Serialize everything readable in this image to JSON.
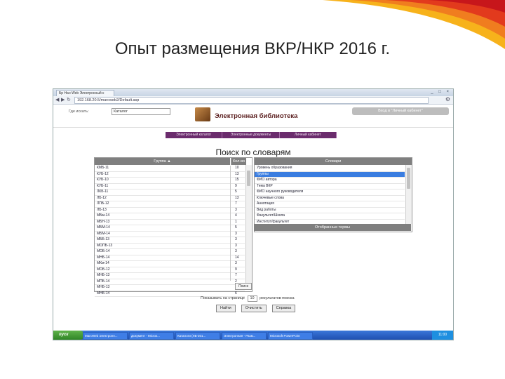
{
  "slide": {
    "title": "Опыт размещения ВКР/НКР 2016 г."
  },
  "browser": {
    "tab_title": "Бр Нан Web Электронный к",
    "window_buttons": "_ □ ×",
    "url": "192.168.20.5/marcweb2/Default.asp",
    "back_glyph": "◀",
    "forward_glyph": "▶",
    "reload_glyph": "↻",
    "wrench_glyph": "⚙"
  },
  "site": {
    "find_label": "Где искать:",
    "find_select": "Каталог",
    "logo_text": "Электронная библиотека",
    "cabinet_button": "Вход в \"Личный кабинет\"",
    "menu": [
      "Электронный каталог",
      "Электронные документы",
      "Личный кабинет"
    ],
    "heading": "Поиск по словарям"
  },
  "groups_panel": {
    "col_group": "Группа ▲",
    "col_count": "Кол-во",
    "search_label": "Поиск",
    "rows": [
      [
        "КМБ-11",
        "10"
      ],
      [
        "КУБ-12",
        "13"
      ],
      [
        "КУБ-10",
        "15"
      ],
      [
        "КУБ-11",
        "9"
      ],
      [
        "ЛКБ-11",
        "5"
      ],
      [
        "ЛБ-12",
        "13"
      ],
      [
        "ЛПБ-12",
        "7"
      ],
      [
        "ЛБ-13",
        "3"
      ],
      [
        "МБм-14",
        "4"
      ],
      [
        "МБН-13",
        "1"
      ],
      [
        "МБМ-14",
        "5"
      ],
      [
        "МБМ-14",
        "3"
      ],
      [
        "МББ-13",
        "3"
      ],
      [
        "МОПБ-13",
        "3"
      ],
      [
        "МОБ-14",
        "3"
      ],
      [
        "МНБ-14",
        "14"
      ],
      [
        "МКм-14",
        "3"
      ],
      [
        "МОБ-12",
        "9"
      ],
      [
        "МНБ-13",
        "7"
      ],
      [
        "МПБ-14",
        "2"
      ],
      [
        "МНБ-13",
        "3"
      ],
      [
        "МНБ-14",
        "6"
      ]
    ]
  },
  "dict_panel": {
    "header": "Словари",
    "rows": [
      "Уровень образования",
      "Группы",
      "ФИО автора",
      "Тема ВКР",
      "ФИО научного руководителя",
      "Ключевые слова",
      "Аннотация",
      "Вид работы",
      "Факультет/Школа",
      "Институт/факультет"
    ],
    "selected_index": 1,
    "terms_button": "Отобранные термы"
  },
  "pager": {
    "show_prefix": "Показывать на странице",
    "per_page": "10",
    "show_suffix": "результатов поиска"
  },
  "actions": [
    "Найти",
    "Очистить",
    "Справка"
  ],
  "taskbar": {
    "start": "пуск",
    "items": [
      "MarcWeb Электронн...",
      "Документ - Micros...",
      "Каталоги (ЛБ-201...",
      "Электронная - Разм...",
      "Microsoft PowerPoint"
    ],
    "tray": "11:00"
  }
}
